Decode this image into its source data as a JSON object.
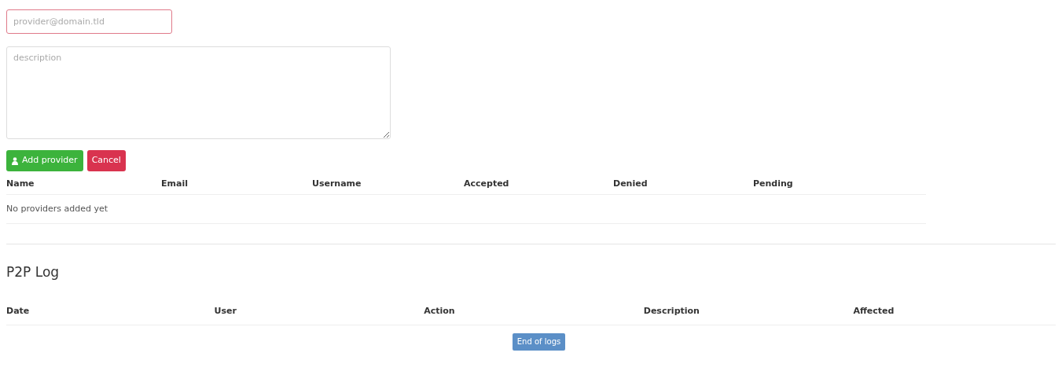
{
  "email_field": {
    "placeholder": "provider@domain.tld",
    "invalid": true
  },
  "description_field": {
    "placeholder": "description"
  },
  "buttons": {
    "add": "Add provider",
    "cancel": "Cancel"
  },
  "providers_table": {
    "columns": [
      "Name",
      "Email",
      "Username",
      "Accepted",
      "Denied",
      "Pending"
    ],
    "empty_message": "No providers added yet"
  },
  "log": {
    "title": "P2P Log",
    "columns": [
      "Date",
      "User",
      "Action",
      "Description",
      "Affected"
    ],
    "end_button": "End of logs"
  }
}
